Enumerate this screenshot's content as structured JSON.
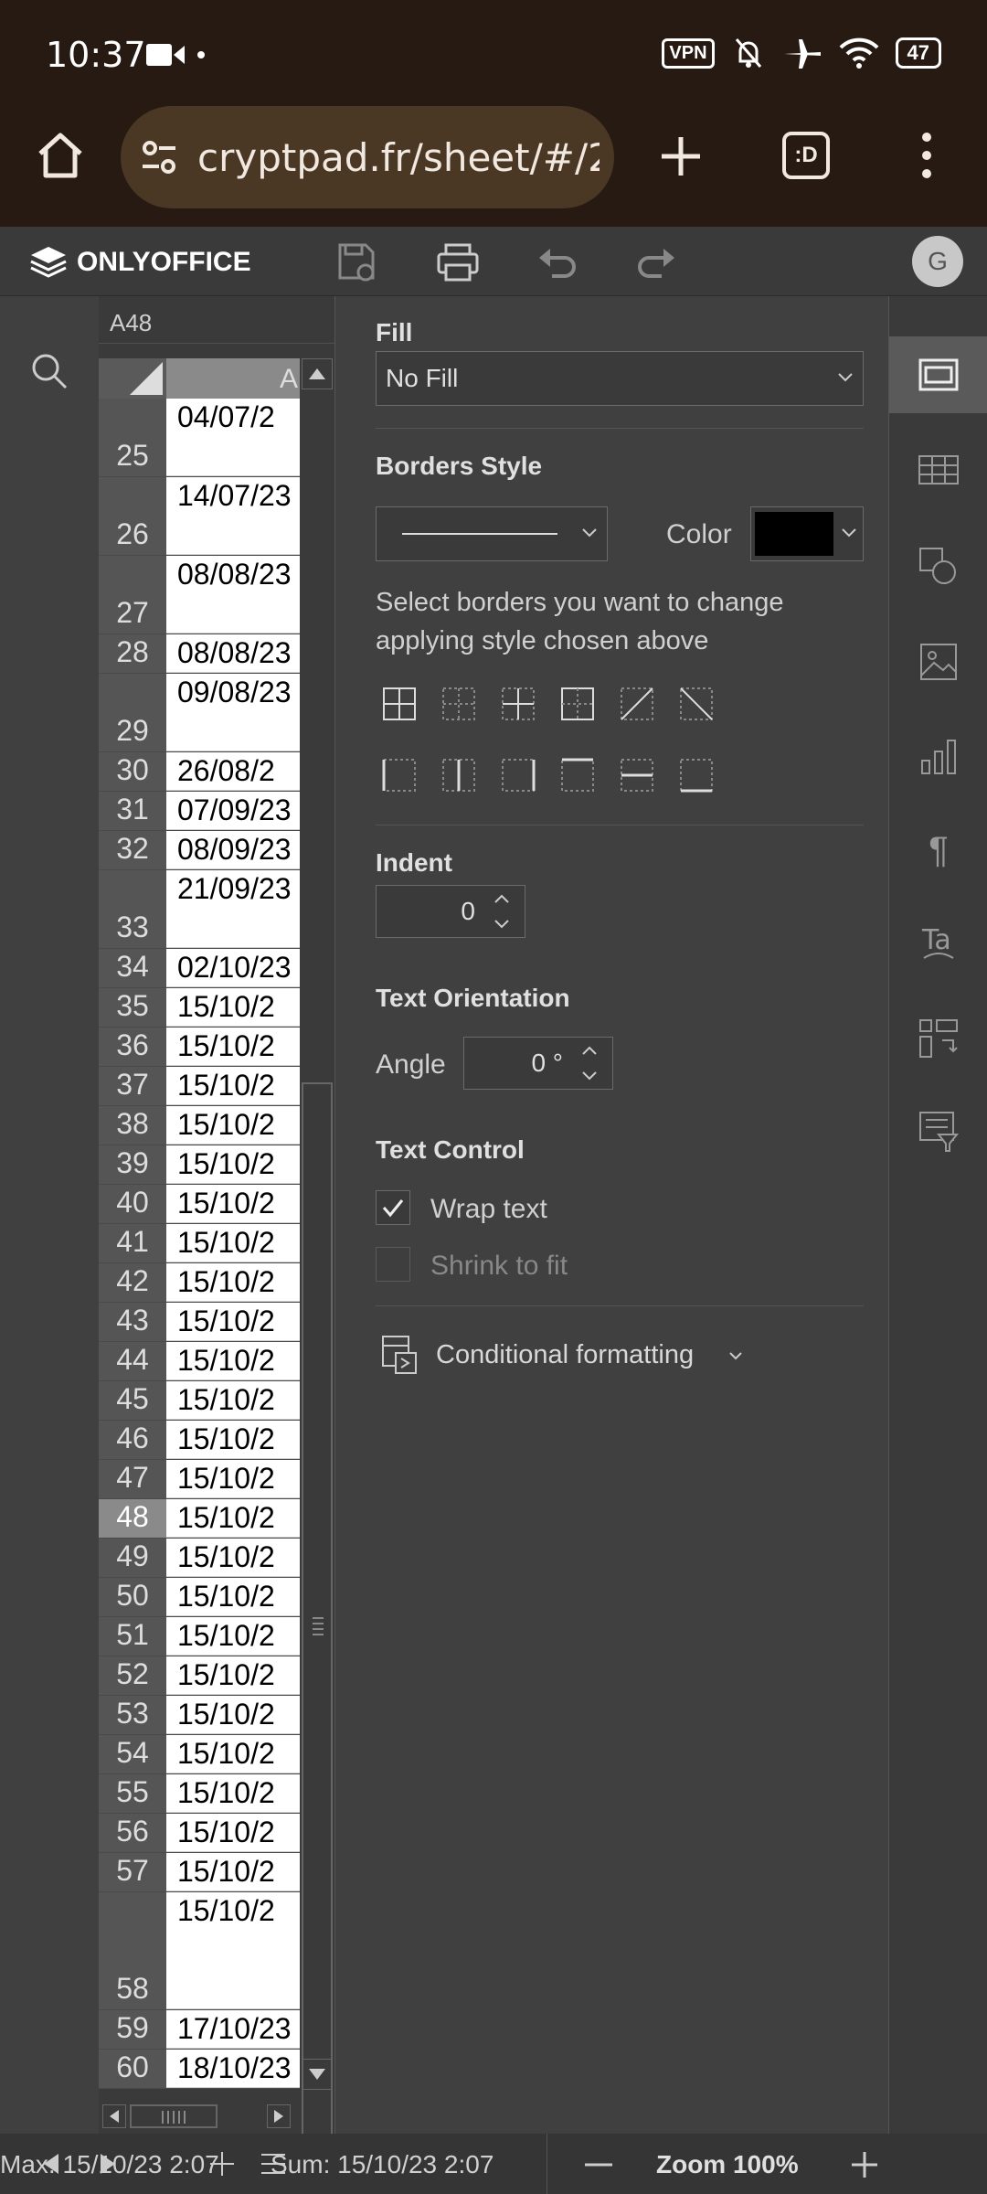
{
  "status": {
    "time": "10:37",
    "battery": "47",
    "vpn": "VPN"
  },
  "browser": {
    "url": "cryptpad.fr/sheet/#/2/"
  },
  "app": {
    "name": "ONLYOFFICE",
    "avatar": "G"
  },
  "sheet": {
    "cell_ref": "A48",
    "col_header": "A",
    "rows": [
      {
        "n": "25",
        "v": "04/07/2",
        "h": 86
      },
      {
        "n": "26",
        "v": "14/07/23",
        "h": 86
      },
      {
        "n": "27",
        "v": "08/08/23",
        "h": 86
      },
      {
        "n": "28",
        "v": "08/08/23",
        "h": 43
      },
      {
        "n": "29",
        "v": "09/08/23",
        "h": 86
      },
      {
        "n": "30",
        "v": "26/08/2",
        "h": 43
      },
      {
        "n": "31",
        "v": "07/09/23",
        "h": 43
      },
      {
        "n": "32",
        "v": "08/09/23",
        "h": 43
      },
      {
        "n": "33",
        "v": "21/09/23",
        "h": 86
      },
      {
        "n": "34",
        "v": "02/10/23",
        "h": 43
      },
      {
        "n": "35",
        "v": "15/10/2",
        "h": 43
      },
      {
        "n": "36",
        "v": "15/10/2",
        "h": 43
      },
      {
        "n": "37",
        "v": "15/10/2",
        "h": 43
      },
      {
        "n": "38",
        "v": "15/10/2",
        "h": 43
      },
      {
        "n": "39",
        "v": "15/10/2",
        "h": 43
      },
      {
        "n": "40",
        "v": "15/10/2",
        "h": 43
      },
      {
        "n": "41",
        "v": "15/10/2",
        "h": 43
      },
      {
        "n": "42",
        "v": "15/10/2",
        "h": 43
      },
      {
        "n": "43",
        "v": "15/10/2",
        "h": 43
      },
      {
        "n": "44",
        "v": "15/10/2",
        "h": 43
      },
      {
        "n": "45",
        "v": "15/10/2",
        "h": 43
      },
      {
        "n": "46",
        "v": "15/10/2",
        "h": 43
      },
      {
        "n": "47",
        "v": "15/10/2",
        "h": 43
      },
      {
        "n": "48",
        "v": "15/10/2",
        "h": 43,
        "selected": true
      },
      {
        "n": "49",
        "v": "15/10/2",
        "h": 43
      },
      {
        "n": "50",
        "v": "15/10/2",
        "h": 43
      },
      {
        "n": "51",
        "v": "15/10/2",
        "h": 43
      },
      {
        "n": "52",
        "v": "15/10/2",
        "h": 43
      },
      {
        "n": "53",
        "v": "15/10/2",
        "h": 43
      },
      {
        "n": "54",
        "v": "15/10/2",
        "h": 43
      },
      {
        "n": "55",
        "v": "15/10/2",
        "h": 43
      },
      {
        "n": "56",
        "v": "15/10/2",
        "h": 43
      },
      {
        "n": "57",
        "v": "15/10/2",
        "h": 43
      },
      {
        "n": "58",
        "v": "15/10/2",
        "h": 129
      },
      {
        "n": "59",
        "v": "17/10/23",
        "h": 43
      },
      {
        "n": "60",
        "v": "18/10/23",
        "h": 43
      }
    ]
  },
  "panel": {
    "fill_label": "Fill",
    "fill_value": "No Fill",
    "borders_style_label": "Borders Style",
    "color_label": "Color",
    "border_color": "#000000",
    "borders_hint": "Select borders you want to change applying style chosen above",
    "indent_label": "Indent",
    "indent_value": "0",
    "text_orientation_label": "Text Orientation",
    "angle_label": "Angle",
    "angle_value": "0 °",
    "text_control_label": "Text Control",
    "wrap_text_label": "Wrap text",
    "wrap_text_checked": true,
    "shrink_label": "Shrink to fit",
    "shrink_checked": false,
    "cond_format_label": "Conditional formatting"
  },
  "bottom": {
    "max_text": "Max: 15/10/23 2:07",
    "sum_text": "Sum: 15/10/23 2:07",
    "zoom_text": "Zoom 100%"
  }
}
